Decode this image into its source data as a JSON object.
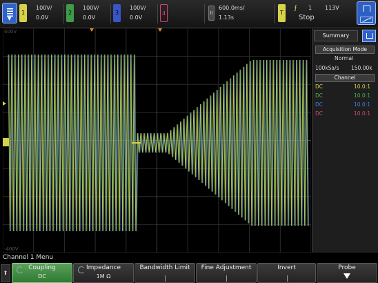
{
  "menu_icon": "menu-list-icon",
  "channels": [
    {
      "id": "1",
      "tag": "1",
      "scale": "100V/",
      "offset": "0.0V",
      "color": "#d8d24a",
      "on": true
    },
    {
      "id": "2",
      "tag": "2",
      "scale": "100V/",
      "offset": "0.0V",
      "color": "#3f9a4a",
      "on": true
    },
    {
      "id": "3",
      "tag": "3",
      "scale": "100V/",
      "offset": "0.0V",
      "color": "#3a55c8",
      "on": true
    },
    {
      "id": "4",
      "tag": "4",
      "scale": "",
      "offset": "",
      "color": "#d1457a",
      "on": false
    }
  ],
  "horizontal": {
    "run_icon": "pause-icon",
    "scale": "600.0ms/",
    "position": "1.13s"
  },
  "trigger": {
    "tag": "T",
    "edge": "rising-edge-icon",
    "source": "1",
    "level": "113V",
    "mode": "Stop"
  },
  "plot": {
    "top_label": "400V",
    "bottom_label": "-400V"
  },
  "sidebar": {
    "title": "Summary",
    "acq_label": "Acquisition Mode",
    "acq_mode": "Normal",
    "sample_rate": "100kSa/s",
    "memory": "150.00k",
    "channel_label": "Channel",
    "channels": [
      {
        "coupling": "DC",
        "probe": "10.0:1",
        "color": "#d8d24a"
      },
      {
        "coupling": "DC",
        "probe": "10.0:1",
        "color": "#3f9a4a"
      },
      {
        "coupling": "DC",
        "probe": "10.0:1",
        "color": "#4a7be0"
      },
      {
        "coupling": "DC",
        "probe": "10.0:1",
        "color": "#d1457a"
      }
    ]
  },
  "menu_title": "Channel 1 Menu",
  "softkeys": [
    {
      "label": "Coupling",
      "value": "DC",
      "active": true
    },
    {
      "label": "Impedance",
      "value": "1M Ω",
      "active": false
    },
    {
      "label": "Bandwidth Limit",
      "value": "",
      "active": false
    },
    {
      "label": "Fine Adjustment",
      "value": "",
      "active": false
    },
    {
      "label": "Invert",
      "value": "",
      "active": false
    },
    {
      "label": "Probe",
      "value": "",
      "active": false
    }
  ],
  "colors": {
    "ch1": "#d8d24a",
    "ch2": "#3f9a4a",
    "ch3": "#3a55c8",
    "ch4": "#d1457a",
    "grid": "#2c2c2c"
  }
}
